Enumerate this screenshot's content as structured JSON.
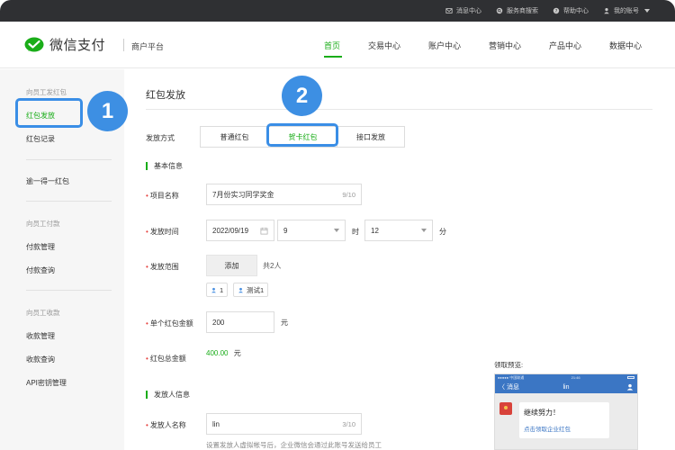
{
  "topbar": {
    "items": [
      {
        "label": "消息中心",
        "icon": "mail-icon"
      },
      {
        "label": "服务商搜索",
        "icon": "search-circle-icon"
      },
      {
        "label": "帮助中心",
        "icon": "help-icon"
      },
      {
        "label": "我的账号",
        "icon": "user-icon"
      }
    ]
  },
  "header": {
    "logo_text": "微信支付",
    "platform": "商户平台",
    "nav": [
      "首页",
      "交易中心",
      "账户中心",
      "营销中心",
      "产品中心",
      "数据中心"
    ],
    "active_nav": 0
  },
  "sidebar": {
    "group1": "向员工发红包",
    "item_send": "红包发放",
    "item_record": "红包记录",
    "item_yide": "逾一得一红包",
    "group2": "向员工付款",
    "item_pay_manage": "付款管理",
    "item_pay_query": "付款查询",
    "group3": "向员工收款",
    "item_collect_manage": "收款管理",
    "item_collect_query": "收款查询",
    "item_api": "API密钥管理"
  },
  "annotations": {
    "step1": "1",
    "step2": "2"
  },
  "main": {
    "title": "红包发放",
    "method_label": "发放方式",
    "methods": [
      "普通红包",
      "贺卡红包",
      "接口发放"
    ],
    "active_method": 1,
    "section_basic": "基本信息",
    "project_label": "项目名称",
    "project_value": "7月份实习同学奖金",
    "project_count": "9/10",
    "time_label": "发放时间",
    "date_value": "2022/09/19",
    "hour_value": "9",
    "hour_unit": "时",
    "minute_value": "12",
    "minute_unit": "分",
    "range_label": "发放范围",
    "add_button": "添加",
    "range_count": "共2人",
    "tags": [
      "1",
      "测试1"
    ],
    "single_label": "单个红包金额",
    "single_value": "200",
    "single_unit": "元",
    "total_label": "红包总金额",
    "total_value": "400.00",
    "total_unit": "元",
    "section_sender": "发放人信息",
    "sender_label": "发放人名称",
    "sender_value": "lin",
    "sender_count": "3/10",
    "sender_hint": "设置发放人虚拟帐号后，企业微信会通过此账号发送给员工"
  },
  "preview": {
    "label": "领取预览:",
    "status_carrier": "●●●●● 中国联通",
    "status_time": "21:46",
    "back": "〈 消息",
    "contact": "lin",
    "msg_title": "继续努力！",
    "msg_link": "点击领取企业红包"
  },
  "colors": {
    "accent": "#1aad19",
    "highlight": "#3a8ee6",
    "topbar": "#2f3033"
  }
}
